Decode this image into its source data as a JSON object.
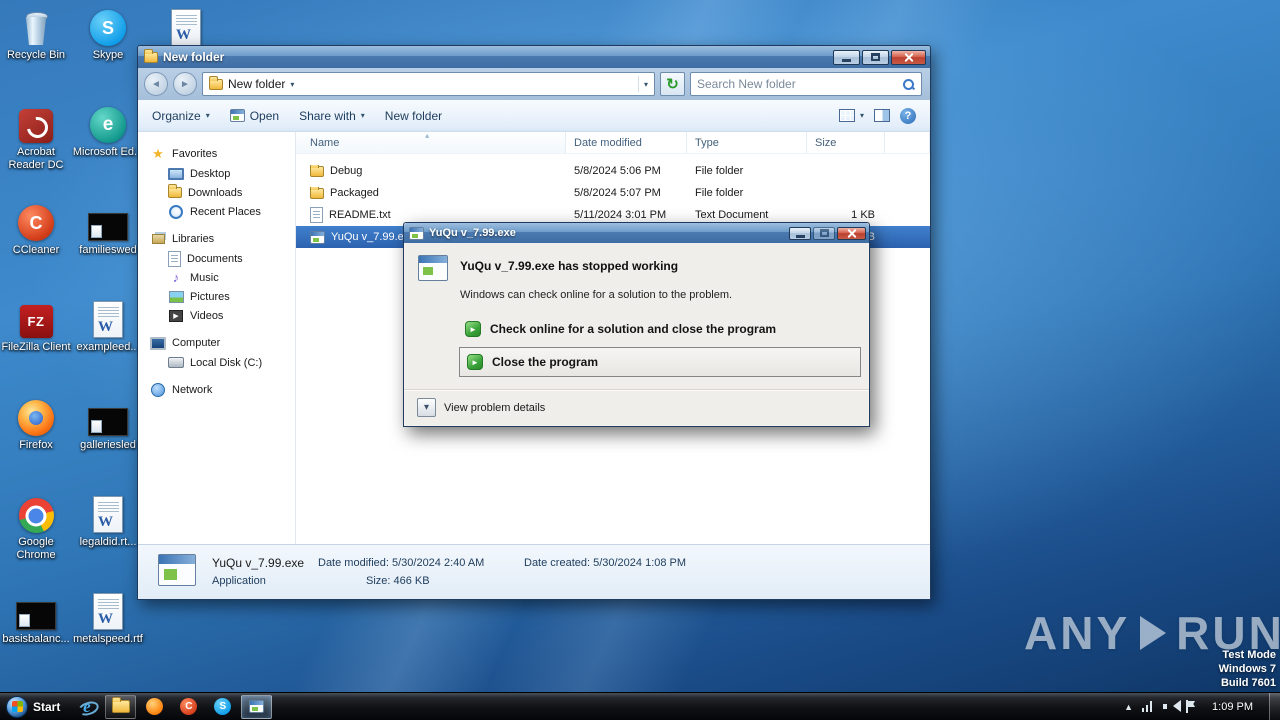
{
  "desktop": {
    "icons": [
      {
        "label": "Recycle Bin"
      },
      {
        "label": "Acrobat Reader DC"
      },
      {
        "label": "CCleaner"
      },
      {
        "label": "FileZilla Client"
      },
      {
        "label": "Firefox"
      },
      {
        "label": "Google Chrome"
      },
      {
        "label": "basisbalanc..."
      },
      {
        "label": "Skype"
      },
      {
        "label": "Microsoft Ed..."
      },
      {
        "label": "familieswed"
      },
      {
        "label": "exampleed..."
      },
      {
        "label": "galleriesled"
      },
      {
        "label": "legaldid.rt..."
      },
      {
        "label": "metalspeed.rtf"
      }
    ]
  },
  "explorer": {
    "title": "New folder",
    "breadcrumb": "New folder",
    "search_placeholder": "Search New folder",
    "toolbar": {
      "organize": "Organize",
      "open": "Open",
      "share": "Share with",
      "new_folder": "New folder"
    },
    "columns": {
      "name": "Name",
      "date": "Date modified",
      "type": "Type",
      "size": "Size"
    },
    "sidebar": {
      "favorites": "Favorites",
      "desktop": "Desktop",
      "downloads": "Downloads",
      "recent": "Recent Places",
      "libraries": "Libraries",
      "documents": "Documents",
      "music": "Music",
      "pictures": "Pictures",
      "videos": "Videos",
      "computer": "Computer",
      "local_disk": "Local Disk (C:)",
      "network": "Network"
    },
    "files": [
      {
        "name": "Debug",
        "date": "5/8/2024 5:06 PM",
        "type": "File folder",
        "size": ""
      },
      {
        "name": "Packaged",
        "date": "5/8/2024 5:07 PM",
        "type": "File folder",
        "size": ""
      },
      {
        "name": "README.txt",
        "date": "5/11/2024 3:01 PM",
        "type": "Text Document",
        "size": "1 KB"
      },
      {
        "name": "YuQu v_7.99.exe",
        "date": "5/30/2024 2:40 AM",
        "type": "Application",
        "size": "466 KB"
      }
    ],
    "details": {
      "name": "YuQu v_7.99.exe",
      "type": "Application",
      "modified": "Date modified: 5/30/2024 2:40 AM",
      "created": "Date created: 5/30/2024 1:08 PM",
      "size": "Size: 466 KB"
    }
  },
  "dialog": {
    "title": "YuQu v_7.99.exe",
    "heading": "YuQu v_7.99.exe has stopped working",
    "message": "Windows can check online for a solution to the problem.",
    "action_online": "Check online for a solution and close the program",
    "action_close": "Close the program",
    "details_toggle": "View problem details"
  },
  "taskbar": {
    "start": "Start",
    "clock": "1:09 PM"
  },
  "watermark": {
    "any": "ANY",
    "run": "RUN",
    "line1": "Test Mode",
    "line2": "Windows 7",
    "line3": "Build 7601"
  }
}
